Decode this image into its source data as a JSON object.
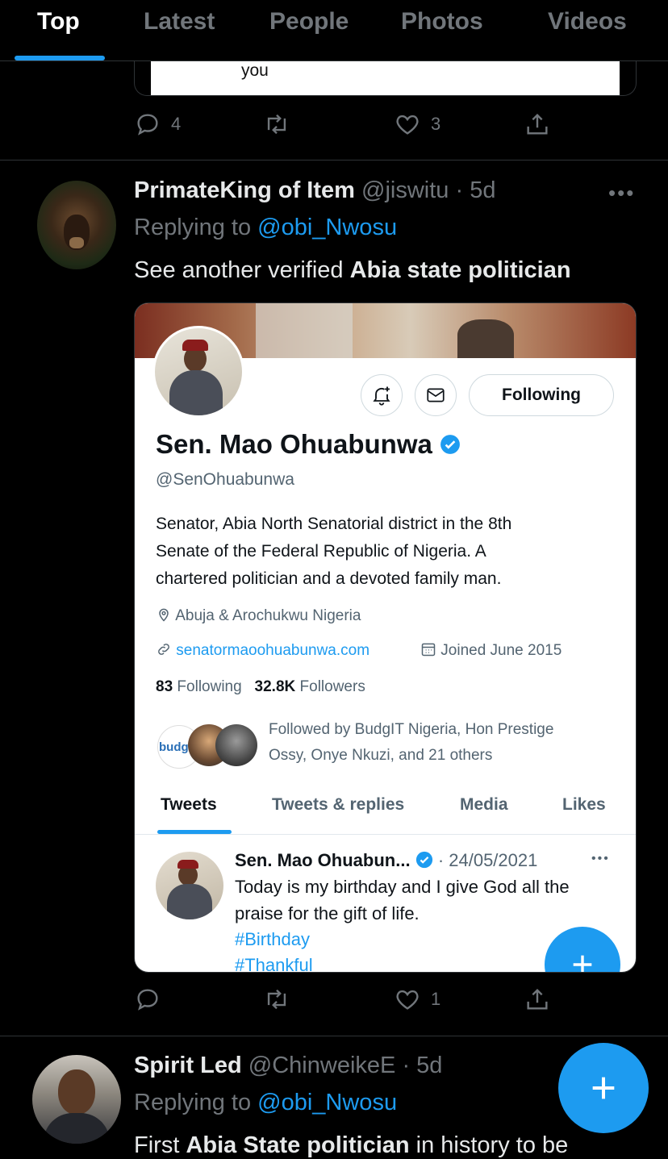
{
  "tabs": {
    "items": [
      {
        "label": "Top"
      },
      {
        "label": "Latest"
      },
      {
        "label": "People"
      },
      {
        "label": "Photos"
      },
      {
        "label": "Videos"
      }
    ]
  },
  "tweet1": {
    "quote_fragment": "you",
    "reply_count": "4",
    "retweet_count": "",
    "like_count": "3"
  },
  "tweet2": {
    "name": "PrimateKing of Item",
    "handle": "@jiswitu",
    "dot": "·",
    "time": "5d",
    "replying_prefix": "Replying to",
    "replying_to": "@obi_Nwosu",
    "text_plain": "See another verified",
    "text_bold": "Abia state politician",
    "more": "•••",
    "reply_count": "",
    "retweet_count": "",
    "like_count": "1",
    "screenshot": {
      "following_label": "Following",
      "profile_name": "Sen. Mao Ohuabunwa",
      "profile_handle": "@SenOhuabunwa",
      "bio_line1": "Senator, Abia North Senatorial district in the 8th",
      "bio_line2": "Senate of the Federal Republic of Nigeria. A",
      "bio_line3": "chartered politician and a devoted family man.",
      "location": "Abuja & Arochukwu Nigeria",
      "website": "senatormaoohuabunwa.com",
      "joined": "Joined June 2015",
      "following_count": "83",
      "following_text": "Following",
      "followers_count": "32.8K",
      "followers_text": "Followers",
      "followed_by_line1": "Followed by BudgIT Nigeria, Hon Prestige",
      "followed_by_line2": "Ossy, Onye Nkuzi, and 21 others",
      "budgit_logo": "budgIT",
      "profile_tabs": [
        "Tweets",
        "Tweets & replies",
        "Media",
        "Likes"
      ],
      "inner_tweet_name": "Sen. Mao Ohuabun...",
      "inner_tweet_date": "· 24/05/2021",
      "inner_tweet_more": "•••",
      "inner_tweet_line1": "Today is my birthday and I give God all the",
      "inner_tweet_line2": "praise for the gift of life.",
      "inner_tweet_tag1": "#Birthday",
      "inner_tweet_tag2": "#Thankful"
    }
  },
  "tweet3": {
    "name": "Spirit Led",
    "handle": "@ChinweikeE",
    "dot": "·",
    "time": "5d",
    "replying_prefix": "Replying to",
    "replying_to": "@obi_Nwosu",
    "text_plain_start": "First",
    "text_bold": "Abia State politician",
    "text_plain_end": "in history to be"
  },
  "colors": {
    "accent": "#1d9bf0",
    "muted": "#71767b",
    "background": "#000000"
  },
  "icons": [
    "reply-icon",
    "retweet-icon",
    "like-icon",
    "share-icon",
    "bell-plus-icon",
    "mail-icon",
    "verified-icon",
    "location-icon",
    "link-icon",
    "calendar-icon",
    "plus-icon"
  ]
}
